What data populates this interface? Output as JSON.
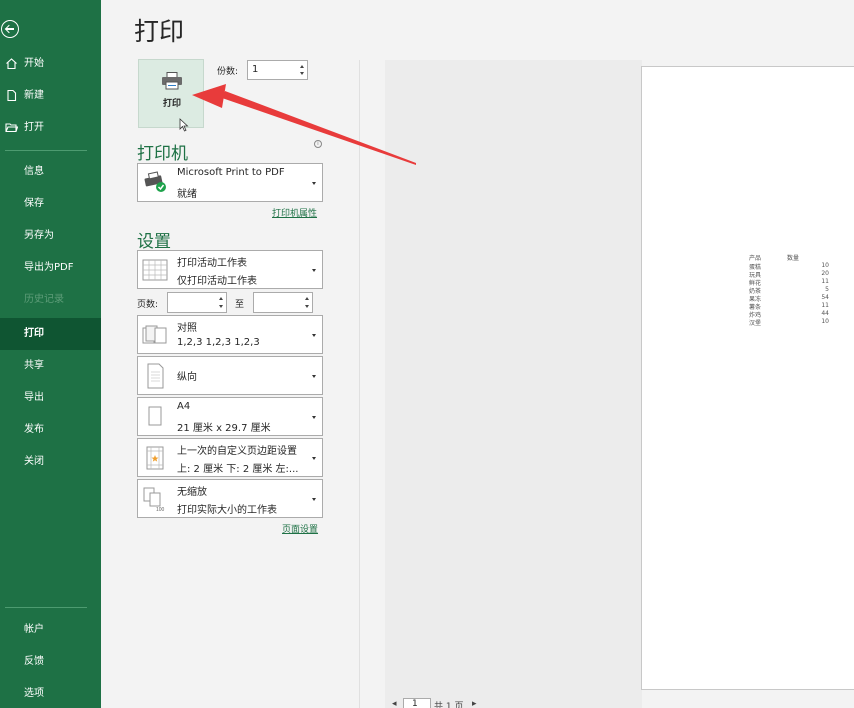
{
  "sidebar": {
    "top_items": [
      {
        "label": "开始",
        "icon": "home-icon"
      },
      {
        "label": "新建",
        "icon": "new-doc-icon"
      },
      {
        "label": "打开",
        "icon": "folder-open-icon"
      }
    ],
    "items": [
      {
        "label": "信息"
      },
      {
        "label": "保存"
      },
      {
        "label": "另存为"
      },
      {
        "label": "导出为PDF"
      },
      {
        "label": "历史记录"
      },
      {
        "label": "打印"
      },
      {
        "label": "共享"
      },
      {
        "label": "导出"
      },
      {
        "label": "发布"
      },
      {
        "label": "关闭"
      }
    ],
    "bottom_items": [
      {
        "label": "帐户"
      },
      {
        "label": "反馈"
      },
      {
        "label": "选项"
      }
    ]
  },
  "page_title": "打印",
  "print_button_label": "打印",
  "copies": {
    "label": "份数:",
    "value": "1"
  },
  "printer": {
    "section_title": "打印机",
    "name": "Microsoft Print to PDF",
    "status": "就绪",
    "properties_link": "打印机属性"
  },
  "settings": {
    "section_title": "设置",
    "what": {
      "line1": "打印活动工作表",
      "line2": "仅打印活动工作表"
    },
    "pages_label": "页数:",
    "to_label": "至",
    "collate": {
      "line1": "对照",
      "line2": "1,2,3    1,2,3    1,2,3"
    },
    "orientation": {
      "line1": "纵向"
    },
    "paper": {
      "line1": "A4",
      "line2": "21 厘米 x 29.7 厘米"
    },
    "margins": {
      "line1": "上一次的自定义页边距设置",
      "line2": "上: 2 厘米 下: 2 厘米 左:..."
    },
    "scaling": {
      "line1": "无缩放",
      "line2": "打印实际大小的工作表"
    },
    "page_setup_link": "页面设置"
  },
  "preview": {
    "headers": [
      "产品",
      "数量"
    ],
    "rows": [
      {
        "name": "蛋糕",
        "qty": "10"
      },
      {
        "name": "玩具",
        "qty": "20"
      },
      {
        "name": "鲜花",
        "qty": "11"
      },
      {
        "name": "奶茶",
        "qty": "5"
      },
      {
        "name": "果冻",
        "qty": "54"
      },
      {
        "name": "薯条",
        "qty": "11"
      },
      {
        "name": "炸鸡",
        "qty": "44"
      },
      {
        "name": "汉堡",
        "qty": "10"
      }
    ]
  },
  "pager": {
    "prev": "◂",
    "value": "1",
    "total": "共 1 页",
    "next": "▸"
  }
}
